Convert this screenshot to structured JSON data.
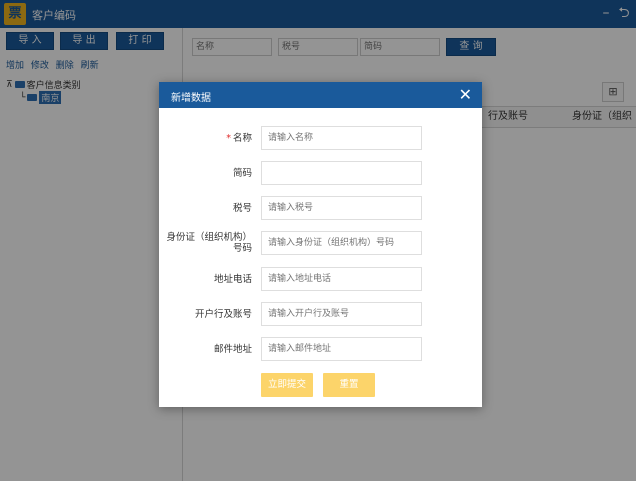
{
  "app": {
    "logo_text": "票",
    "title": "客户编码",
    "minimize_glyph": "–",
    "back_glyph": "⮌"
  },
  "toolbar": {
    "import_label": "导 入",
    "export_label": "导 出",
    "print_label": "打 印"
  },
  "tree_actions": [
    "增加",
    "修改",
    "删除",
    "刷新"
  ],
  "tree": {
    "expander": "⊼",
    "root_label": "客户信息类别",
    "child_prefix": "└",
    "child_label": "南京"
  },
  "search": {
    "name_placeholder": "名称",
    "tax_placeholder": "税号",
    "code_placeholder": "简码",
    "query_label": "查 询"
  },
  "table": {
    "columns": [
      "行及账号",
      "身份证（组织"
    ],
    "grid_icon": "⊞"
  },
  "dialog": {
    "title": "新增数据",
    "close": "✕",
    "required_mark": "*",
    "fields": [
      {
        "label": "名称",
        "placeholder": "请输入名称",
        "required": true
      },
      {
        "label": "简码",
        "placeholder": "",
        "required": false
      },
      {
        "label": "税号",
        "placeholder": "请输入税号",
        "required": false
      },
      {
        "label": "身份证（组织机构）号码",
        "placeholder": "请输入身份证（组织机构）号码",
        "required": false
      },
      {
        "label": "地址电话",
        "placeholder": "请输入地址电话",
        "required": false
      },
      {
        "label": "开户行及账号",
        "placeholder": "请输入开户行及账号",
        "required": false
      },
      {
        "label": "邮件地址",
        "placeholder": "请输入邮件地址",
        "required": false
      }
    ],
    "save_label": "立即提交",
    "reset_label": "重置"
  },
  "colors": {
    "primary": "#1a5a9b",
    "logo": "#f2b51e",
    "button_yellow": "#fcd46a",
    "required": "#e02b2b"
  }
}
